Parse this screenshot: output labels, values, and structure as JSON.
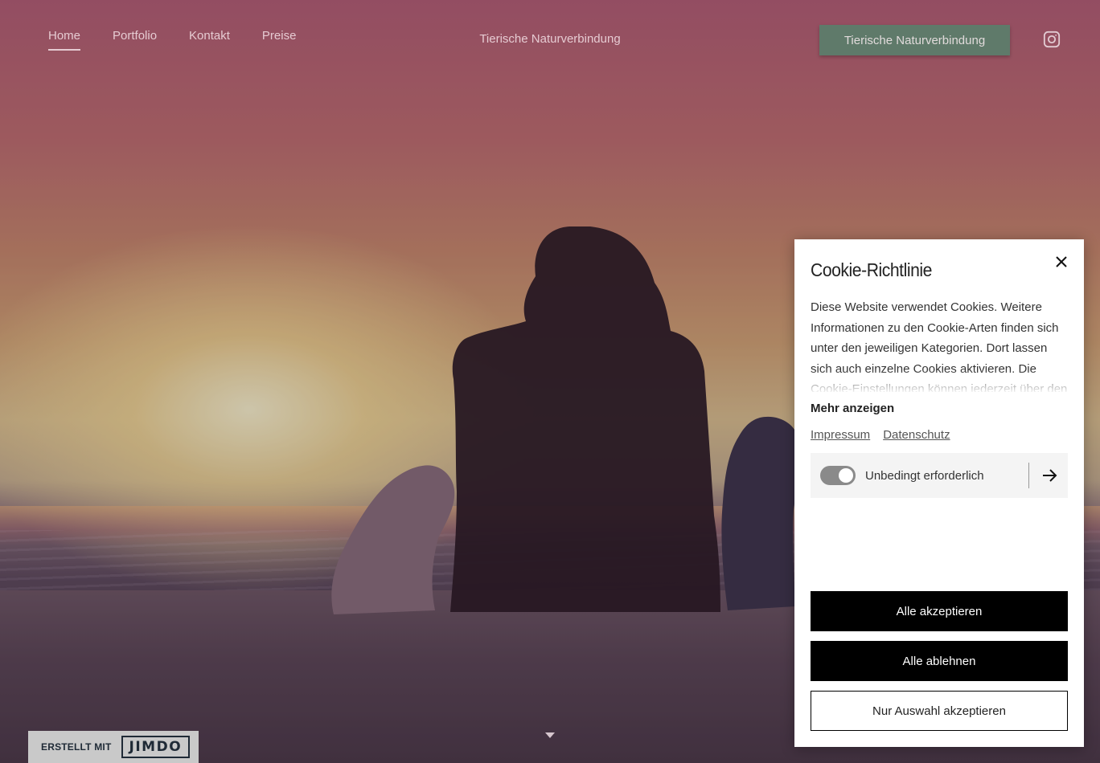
{
  "nav": {
    "items": [
      {
        "label": "Home",
        "active": true
      },
      {
        "label": "Portfolio",
        "active": false
      },
      {
        "label": "Kontakt",
        "active": false
      },
      {
        "label": "Preise",
        "active": false
      }
    ]
  },
  "site_title": "Tierische Naturverbindung",
  "cta_button": "Tierische Naturverbindung",
  "social": {
    "icon": "instagram-icon"
  },
  "colors": {
    "cta": "#5f7a6a",
    "primary_button": "#000000",
    "toggle": "#8a8a8a"
  },
  "jimdo": {
    "made_with": "ERSTELLT MIT",
    "logo": "JIMDO"
  },
  "cookie": {
    "title": "Cookie-Richtlinie",
    "text": "Diese Website verwendet Cookies. Weitere Informationen zu den Cookie-Arten finden sich unter den jeweiligen Kategorien. Dort lassen sich auch einzelne Cookies aktivieren. Die Cookie-Einstellungen können jederzeit über den Link im",
    "more": "Mehr anzeigen",
    "links": [
      "Impressum",
      "Datenschutz"
    ],
    "toggle_label": "Unbedingt erforderlich",
    "toggle_on": true,
    "accept_all": "Alle akzeptieren",
    "reject_all": "Alle ablehnen",
    "accept_selection": "Nur Auswahl akzeptieren"
  }
}
